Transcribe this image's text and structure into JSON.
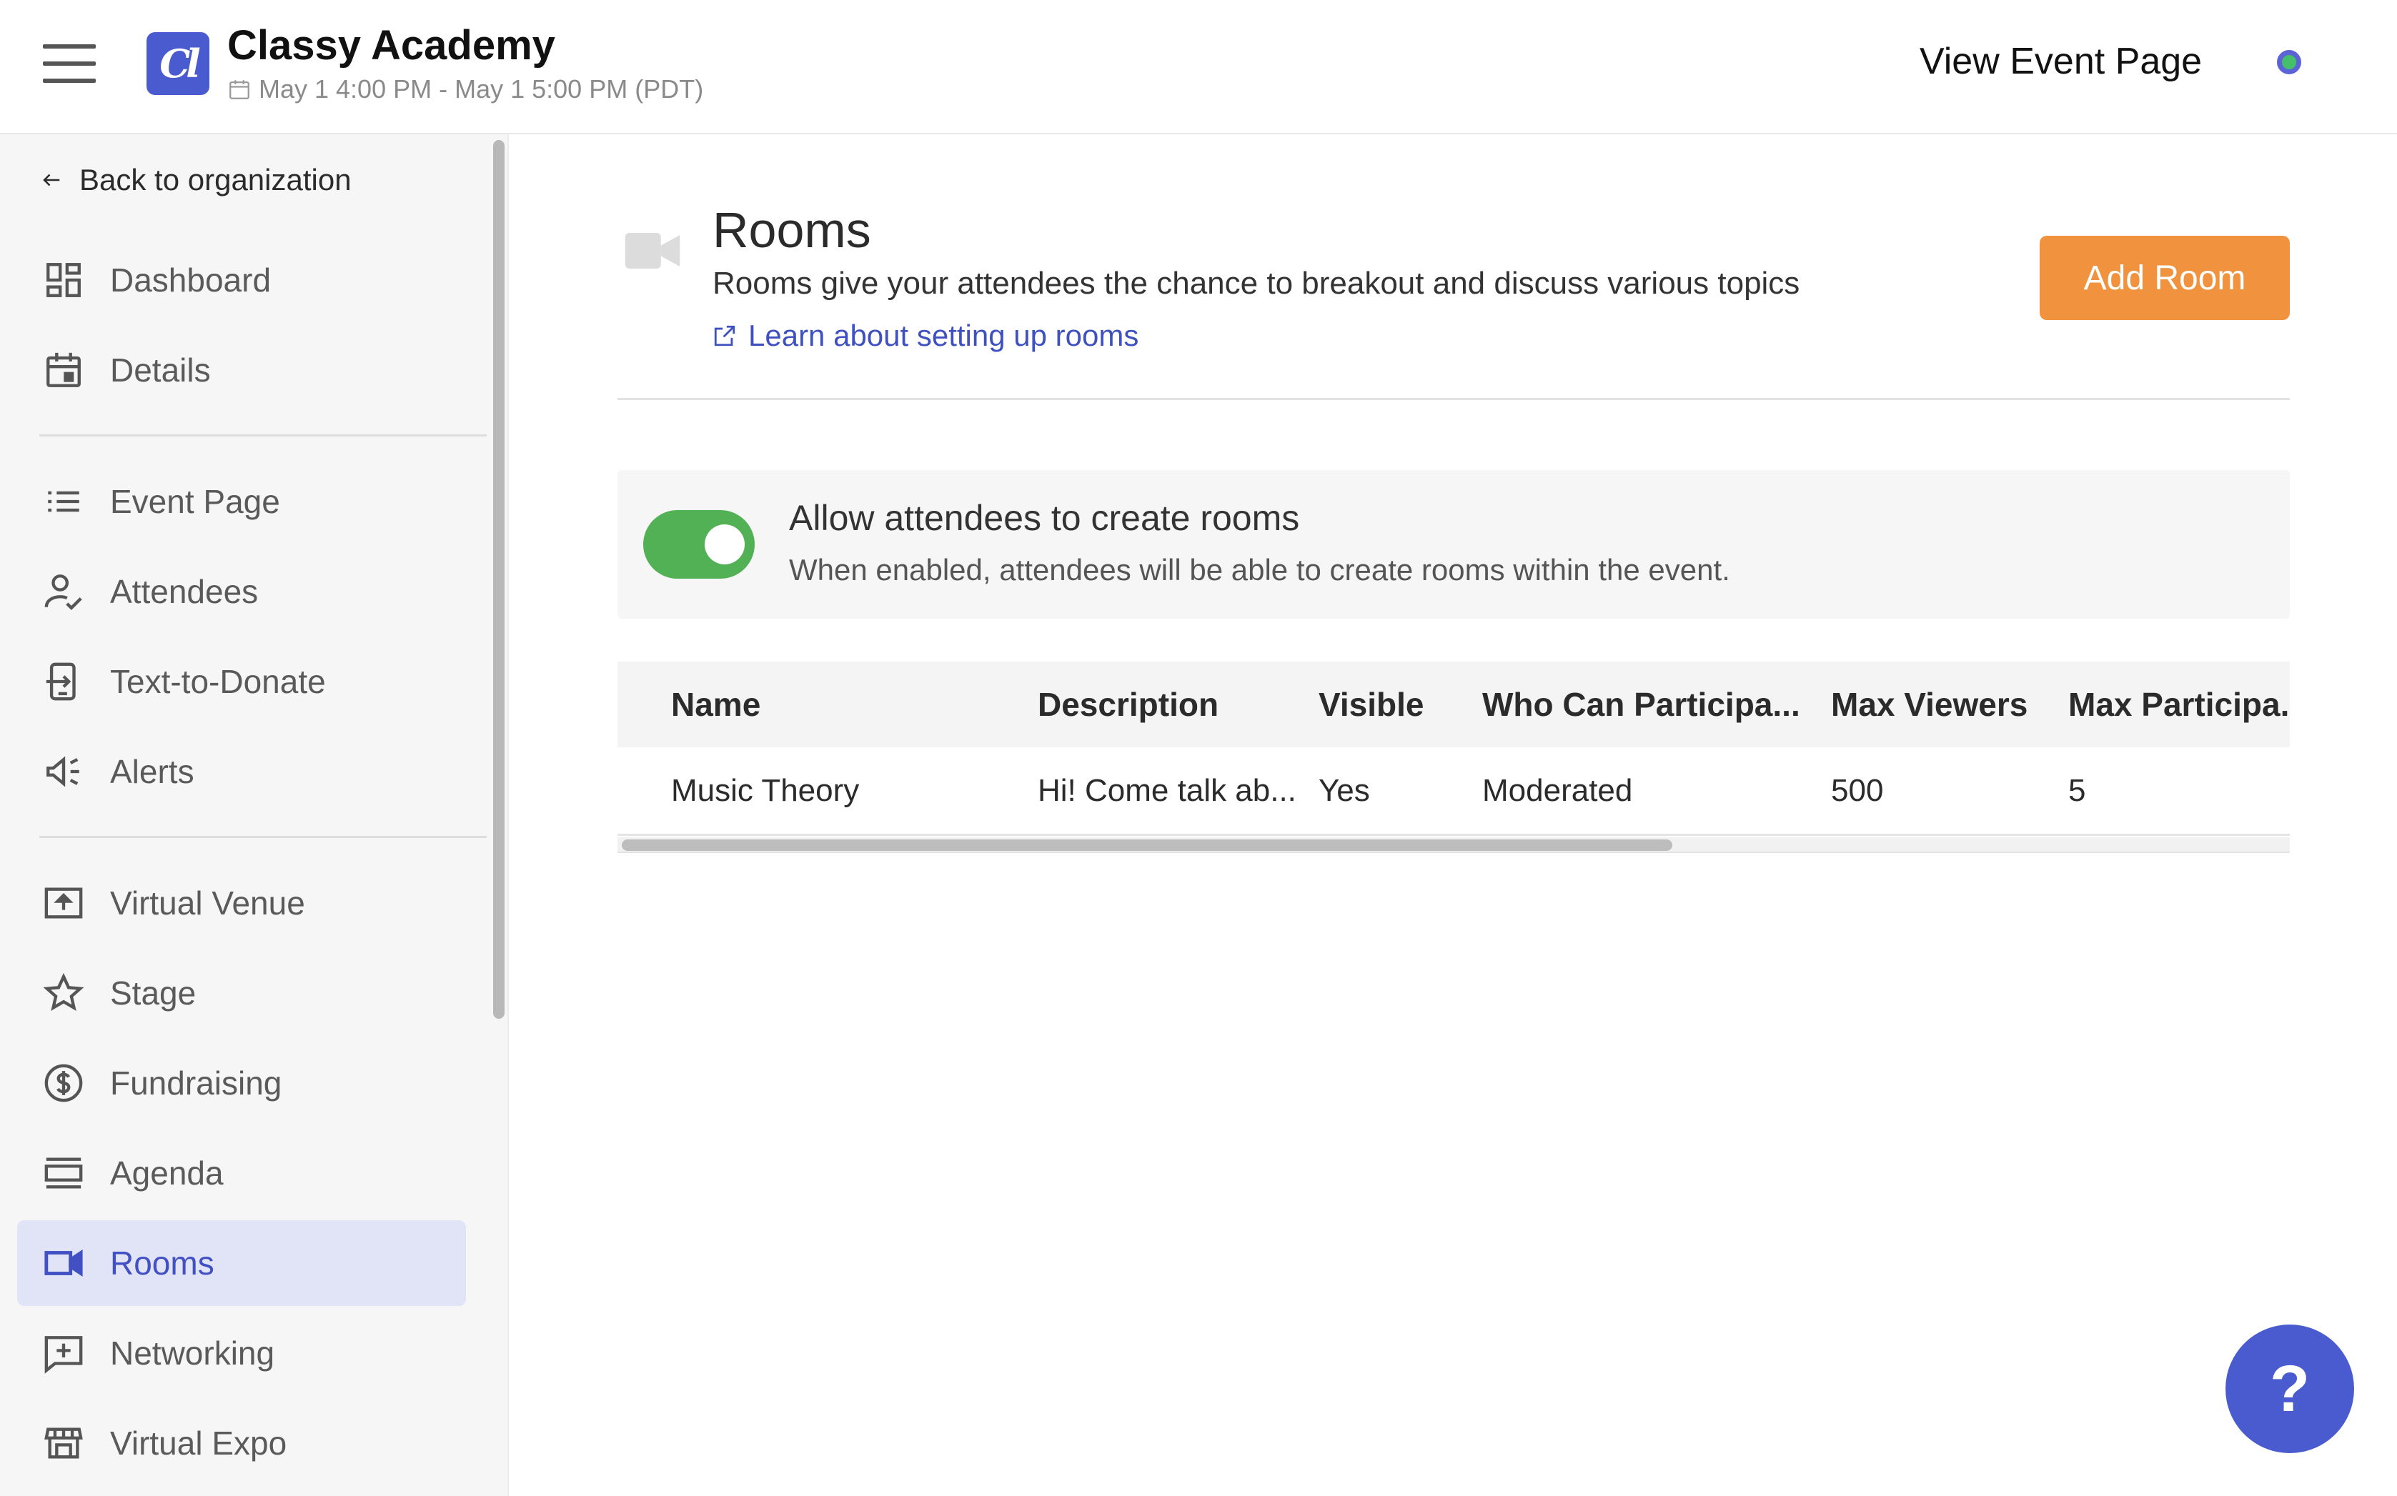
{
  "header": {
    "org_logo_text": "Cl",
    "org_name": "Classy Academy",
    "event_dates": "May 1 4:00 PM - May 1 5:00 PM (PDT)",
    "view_event_label": "View Event Page",
    "status_color": "#44c06a"
  },
  "sidebar": {
    "back_label": "Back to organization",
    "items": [
      {
        "label": "Dashboard",
        "icon": "dashboard-icon"
      },
      {
        "label": "Details",
        "icon": "calendar-icon"
      },
      {
        "label": "Event Page",
        "icon": "list-icon"
      },
      {
        "label": "Attendees",
        "icon": "person-check-icon"
      },
      {
        "label": "Text-to-Donate",
        "icon": "phone-icon"
      },
      {
        "label": "Alerts",
        "icon": "megaphone-icon"
      },
      {
        "label": "Virtual Venue",
        "icon": "upload-icon"
      },
      {
        "label": "Stage",
        "icon": "star-icon"
      },
      {
        "label": "Fundraising",
        "icon": "dollar-icon"
      },
      {
        "label": "Agenda",
        "icon": "agenda-icon"
      },
      {
        "label": "Rooms",
        "icon": "video-camera-icon",
        "active": true
      },
      {
        "label": "Networking",
        "icon": "add-chat-icon"
      },
      {
        "label": "Virtual Expo",
        "icon": "storefront-icon"
      }
    ]
  },
  "main": {
    "title": "Rooms",
    "subtitle": "Rooms give your attendees the chance to breakout and discuss various topics",
    "learn_link": "Learn about setting up rooms",
    "add_button": "Add Room",
    "accent_color": "#f0923e",
    "toggle": {
      "title": "Allow attendees to create rooms",
      "description": "When enabled, attendees will be able to create rooms within the event.",
      "enabled": true
    },
    "table": {
      "columns": [
        "Name",
        "Description",
        "Visible",
        "Who Can Participa...",
        "Max Viewers",
        "Max Participa..."
      ],
      "rows": [
        [
          "Music Theory",
          "Hi! Come talk ab...",
          "Yes",
          "Moderated",
          "500",
          "5"
        ]
      ]
    }
  },
  "help_label": "?"
}
